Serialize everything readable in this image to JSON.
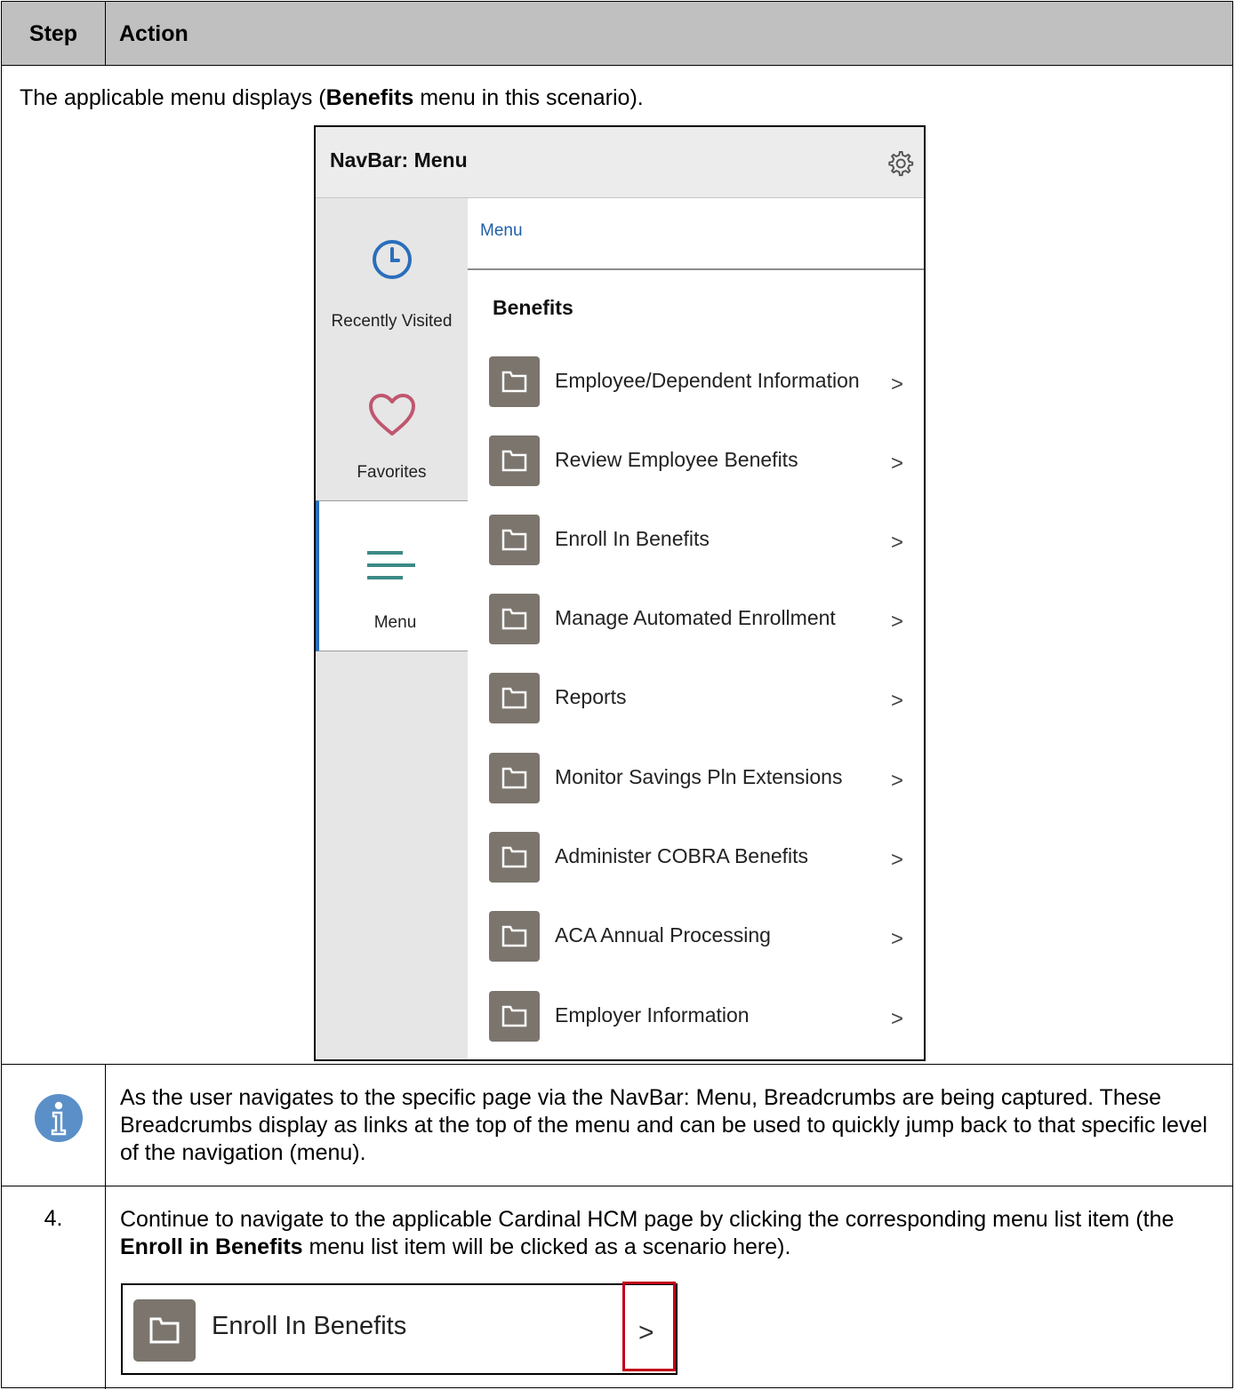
{
  "table": {
    "col_step": "Step",
    "col_action": "Action",
    "intro_pre": "The applicable menu displays (",
    "intro_bold": "Benefits",
    "intro_post": " menu in this scenario)."
  },
  "navbar": {
    "title": "NavBar: Menu",
    "settings_icon": "gear-icon",
    "side": {
      "recent_label": "Recently Visited",
      "favorites_label": "Favorites",
      "menu_label": "Menu"
    },
    "breadcrumb": "Menu",
    "section_title": "Benefits",
    "items": [
      "Employee/Dependent Information",
      "Review Employee Benefits",
      "Enroll In Benefits",
      "Manage Automated Enrollment",
      "Reports",
      "Monitor Savings Pln Extensions",
      "Administer COBRA Benefits",
      "ACA Annual Processing",
      "Employer Information"
    ],
    "chevron": ">"
  },
  "info": {
    "text": "As the user navigates to the specific page via the NavBar: Menu, Breadcrumbs are being captured.  These Breadcrumbs display as links at the top of the menu and can be used to quickly jump back to that specific level of the navigation (menu)."
  },
  "step4": {
    "number": "4.",
    "text_pre": "Continue to navigate to the applicable Cardinal HCM page by clicking the corresponding menu list item (the ",
    "text_bold": "Enroll in Benefits",
    "text_post": " menu list item will be clicked as a scenario here).",
    "example_label": "Enroll In Benefits",
    "example_chevron": ">"
  },
  "colors": {
    "header_bg": "#c0c0c0",
    "folder_tile": "#7b756d",
    "accent_blue": "#2a6ebb",
    "heart": "#c0566f",
    "menu_lines": "#3c8a86",
    "highlight": "#c00018",
    "info_icon": "#5b8fc7"
  }
}
